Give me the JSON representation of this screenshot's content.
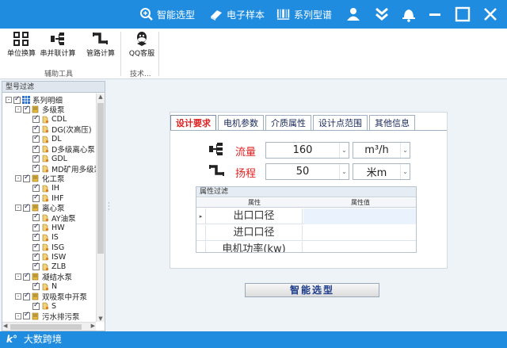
{
  "titlebar": {
    "items": [
      {
        "label": "智能选型",
        "icon": "search-icon"
      },
      {
        "label": "电子样本",
        "icon": "book-icon"
      },
      {
        "label": "系列型谱",
        "icon": "barcode-icon"
      }
    ],
    "buttons": [
      "user-icon",
      "chevron-down-double-icon",
      "bell-icon",
      "minimize-icon",
      "maximize-icon",
      "close-icon"
    ]
  },
  "ribbon": {
    "buttons": [
      {
        "label": "单位换算",
        "icon": "unit-convert-icon"
      },
      {
        "label": "串并联计算",
        "icon": "series-parallel-icon"
      },
      {
        "label": "管路计算",
        "icon": "pipe-icon"
      },
      {
        "label": "QQ客服",
        "icon": "qq-icon"
      }
    ],
    "groups": [
      "辅助工具",
      "技术..."
    ]
  },
  "left_panel": {
    "header": "型号过滤",
    "tree": [
      {
        "label": "系列明细",
        "level": 0,
        "expander": "-",
        "icon": "grid-icon"
      },
      {
        "label": "多级泵",
        "level": 1,
        "expander": "-",
        "icon": "folder-icon"
      },
      {
        "label": "CDL",
        "level": 2,
        "icon": "doc-icon"
      },
      {
        "label": "DG(次高压)",
        "level": 2,
        "icon": "doc-icon"
      },
      {
        "label": "DL",
        "level": 2,
        "icon": "doc-icon"
      },
      {
        "label": "D多级离心泵",
        "level": 2,
        "icon": "doc-icon"
      },
      {
        "label": "GDL",
        "level": 2,
        "icon": "doc-icon"
      },
      {
        "label": "MD矿用多级泵",
        "level": 2,
        "icon": "doc-icon"
      },
      {
        "label": "化工泵",
        "level": 1,
        "expander": "-",
        "icon": "folder-icon"
      },
      {
        "label": "IH",
        "level": 2,
        "icon": "doc-icon"
      },
      {
        "label": "IHF",
        "level": 2,
        "icon": "doc-icon"
      },
      {
        "label": "离心泵",
        "level": 1,
        "expander": "-",
        "icon": "folder-icon"
      },
      {
        "label": "AY油泵",
        "level": 2,
        "icon": "doc-icon"
      },
      {
        "label": "HW",
        "level": 2,
        "icon": "doc-icon"
      },
      {
        "label": "IS",
        "level": 2,
        "icon": "doc-icon"
      },
      {
        "label": "ISG",
        "level": 2,
        "icon": "doc-icon"
      },
      {
        "label": "ISW",
        "level": 2,
        "icon": "doc-icon"
      },
      {
        "label": "ZLB",
        "level": 2,
        "icon": "doc-icon"
      },
      {
        "label": "凝结水泵",
        "level": 1,
        "expander": "-",
        "icon": "folder-icon"
      },
      {
        "label": "N",
        "level": 2,
        "icon": "doc-icon"
      },
      {
        "label": "双吸泵中开泵",
        "level": 1,
        "expander": "-",
        "icon": "folder-icon"
      },
      {
        "label": "S",
        "level": 2,
        "icon": "doc-icon"
      },
      {
        "label": "污水排污泵",
        "level": 1,
        "expander": "-",
        "icon": "folder-icon"
      }
    ]
  },
  "tabs": [
    "设计要求",
    "电机参数",
    "介质属性",
    "设计点范围",
    "其他信息"
  ],
  "params": {
    "flow": {
      "label": "流量",
      "value": "160",
      "unit": "m³/h"
    },
    "head": {
      "label": "扬程",
      "value": "50",
      "unit": "米m"
    }
  },
  "filter": {
    "title": "属性过滤",
    "columns": [
      "属性",
      "属性值"
    ],
    "rows": [
      "出口口径",
      "进口口径",
      "电机功率(kw)"
    ]
  },
  "smart_button": "智能选型",
  "status": {
    "brand": "大数跨境"
  },
  "colors": {
    "titlebar": "#1f8ce0",
    "accent_red": "#dd2222"
  }
}
